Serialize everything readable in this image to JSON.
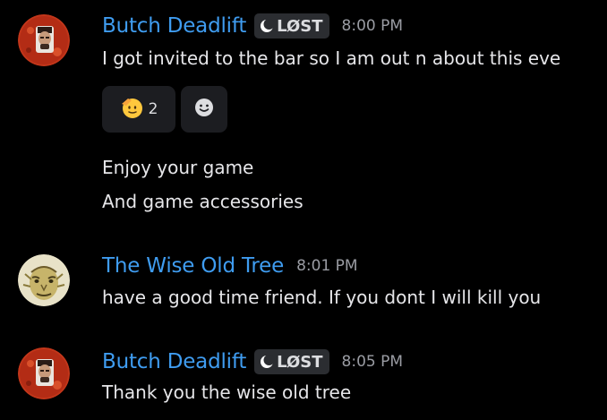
{
  "messages": [
    {
      "author": "Butch Deadlift",
      "tag": "LØST",
      "time": "8:00 PM",
      "lines": [
        "I got invited to the bar so I am out n about this eve"
      ],
      "reactions": [
        {
          "emoji": "saluting-face-icon",
          "count": "2"
        },
        {
          "emoji": "add-reaction-icon"
        }
      ],
      "continuations": [
        "Enjoy your game",
        "And game accessories"
      ]
    },
    {
      "author": "The Wise Old Tree",
      "time": "8:01 PM",
      "lines": [
        "have a good time friend. If you dont I will kill you"
      ]
    },
    {
      "author": "Butch Deadlift",
      "tag": "LØST",
      "time": "8:05 PM",
      "lines": [
        "Thank you the wise old tree"
      ]
    }
  ],
  "colors": {
    "background": "#000000",
    "username": "#3f9cf0",
    "timestamp": "#9a9ca3",
    "tag_bg": "#2b2d31",
    "reaction_bg": "#1c1d21",
    "text": "#e6e6e9"
  }
}
